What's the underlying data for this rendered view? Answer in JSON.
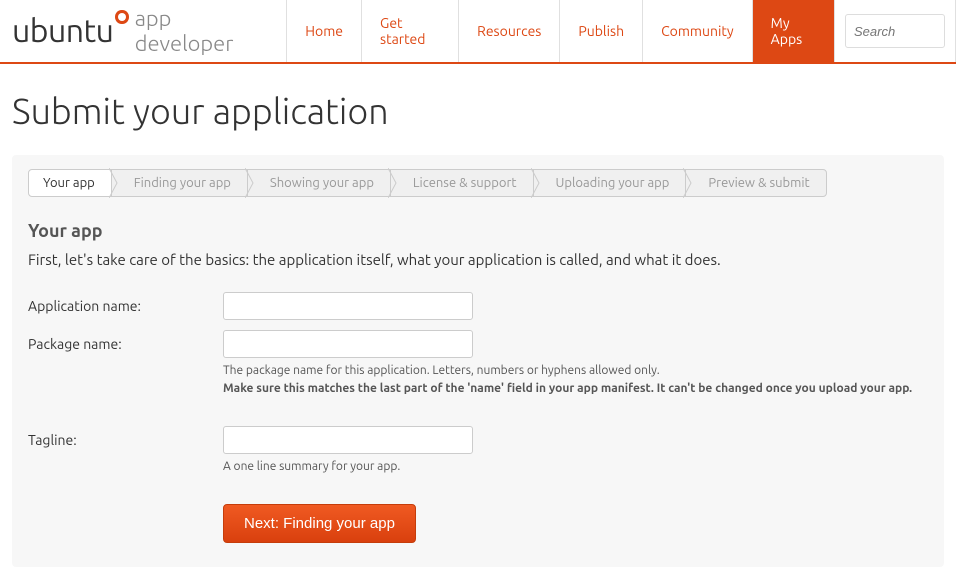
{
  "header": {
    "logo_main": "ubuntu",
    "logo_sub": "app developer",
    "nav": [
      {
        "label": "Home",
        "active": false
      },
      {
        "label": "Get started",
        "active": false
      },
      {
        "label": "Resources",
        "active": false
      },
      {
        "label": "Publish",
        "active": false
      },
      {
        "label": "Community",
        "active": false
      },
      {
        "label": "My Apps",
        "active": true
      }
    ],
    "search_placeholder": "Search"
  },
  "page": {
    "title": "Submit your application"
  },
  "steps": [
    {
      "label": "Your app",
      "active": true
    },
    {
      "label": "Finding your app",
      "active": false
    },
    {
      "label": "Showing your app",
      "active": false
    },
    {
      "label": "License & support",
      "active": false
    },
    {
      "label": "Uploading your app",
      "active": false
    },
    {
      "label": "Preview & submit",
      "active": false
    }
  ],
  "section": {
    "title": "Your app",
    "desc": "First, let's take care of the basics: the application itself, what your application is called, and what it does."
  },
  "form": {
    "app_name": {
      "label": "Application name:",
      "value": ""
    },
    "package_name": {
      "label": "Package name:",
      "value": "",
      "help1": "The package name for this application. Letters, numbers or hyphens allowed only.",
      "help2": "Make sure this matches the last part of the 'name' field in your app manifest. It can't be changed once you upload your app."
    },
    "tagline": {
      "label": "Tagline:",
      "value": "",
      "help": "A one line summary for your app."
    },
    "next_button": "Next: Finding your app"
  }
}
